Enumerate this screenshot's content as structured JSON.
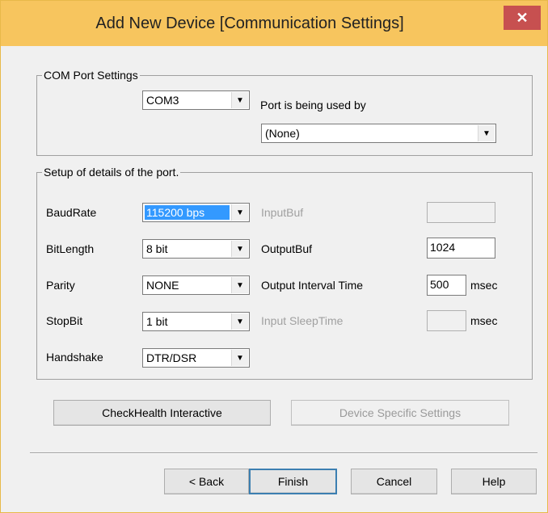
{
  "window": {
    "title": "Add New Device  [Communication Settings]",
    "close_glyph": "✕"
  },
  "com_port": {
    "legend": "COM Port Settings",
    "port_value": "COM3",
    "used_by_label": "Port is being used by",
    "used_by_value": "(None)"
  },
  "details": {
    "legend": "Setup of details of the port.",
    "baudrate_label": "BaudRate",
    "baudrate_value": "115200 bps",
    "bitlength_label": "BitLength",
    "bitlength_value": "8 bit",
    "parity_label": "Parity",
    "parity_value": "NONE",
    "stopbit_label": "StopBit",
    "stopbit_value": "1 bit",
    "handshake_label": "Handshake",
    "handshake_value": "DTR/DSR",
    "inputbuf_label": "InputBuf",
    "inputbuf_value": "",
    "outputbuf_label": "OutputBuf",
    "outputbuf_value": "1024",
    "output_interval_label": "Output Interval Time",
    "output_interval_value": "500",
    "output_interval_unit": "msec",
    "input_sleep_label": "Input SleepTime",
    "input_sleep_value": "",
    "input_sleep_unit": "msec"
  },
  "actions": {
    "checkhealth_label": "CheckHealth Interactive",
    "device_specific_label": "Device Specific Settings"
  },
  "footer": {
    "back_label": "< Back",
    "finish_label": "Finish",
    "cancel_label": "Cancel",
    "help_label": "Help"
  },
  "colors": {
    "titlebar": "#f7c55e",
    "close_button": "#c75050",
    "selection": "#3399ff"
  },
  "icons": {
    "dropdown": "chevron-down-icon",
    "close": "close-icon"
  }
}
